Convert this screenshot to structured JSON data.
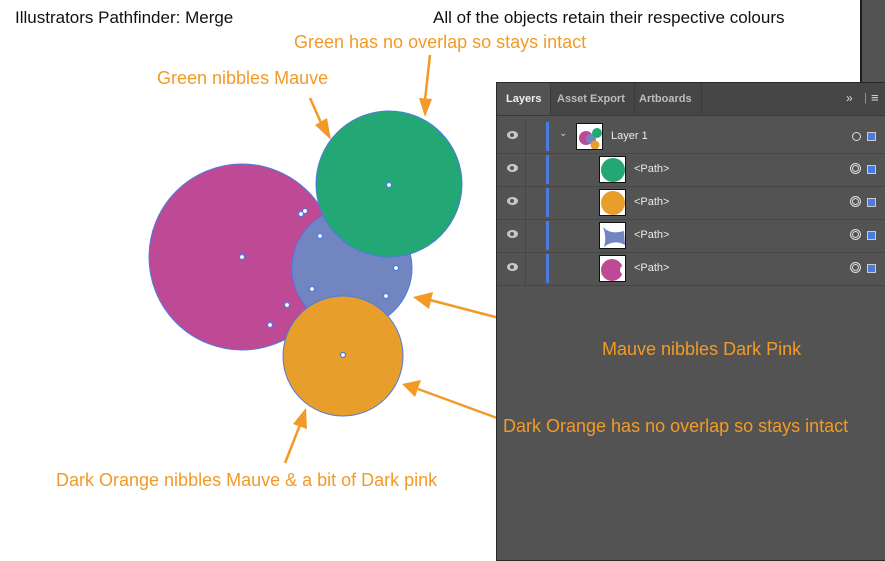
{
  "annotations": {
    "title": "Illustrators Pathfinder: Merge",
    "note_top": "All of the objects retain their respective colours",
    "green_intact": "Green has no overlap so stays intact",
    "green_nibbles": "Green nibbles Mauve",
    "mauve_nibbles": "Mauve nibbles Dark Pink",
    "orange_intact": "Dark Orange has no overlap so stays intact",
    "orange_nibbles": "Dark Orange nibbles Mauve & a bit of Dark pink"
  },
  "colors": {
    "pink": "#be4a95",
    "mauve": "#7185c0",
    "green": "#23a875",
    "orange": "#e89e2a",
    "accent": "#f39a26",
    "selection": "#4c7be0"
  },
  "panel": {
    "tabs": [
      {
        "label": "Layers",
        "active": true
      },
      {
        "label": "Asset Export"
      },
      {
        "label": "Artboards"
      }
    ],
    "overflow_icon": "double-chevron-right-icon",
    "menu_icon": "hamburger-menu-icon",
    "layer": {
      "name": "Layer 1",
      "expanded": true
    },
    "paths": [
      {
        "name": "<Path>",
        "color": "green"
      },
      {
        "name": "<Path>",
        "color": "orange"
      },
      {
        "name": "<Path>",
        "color": "mauve"
      },
      {
        "name": "<Path>",
        "color": "pink"
      }
    ]
  }
}
